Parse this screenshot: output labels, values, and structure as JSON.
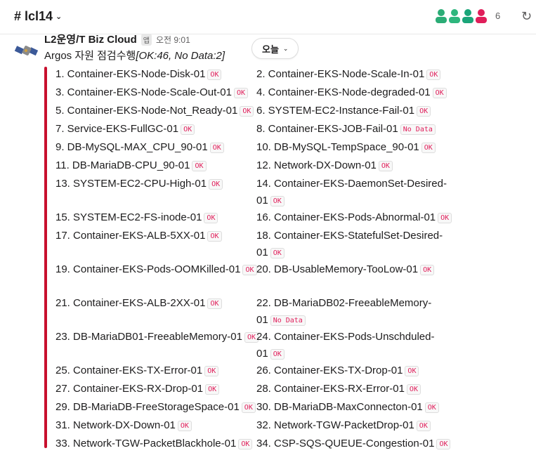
{
  "channel": {
    "name": "# lcl14"
  },
  "members": {
    "count": "6"
  },
  "message": {
    "sender": "L2운영/T Biz Cloud",
    "app_badge": "앱",
    "time": "오전 9:01",
    "title_prefix": "Argos 자원 점검수행",
    "title_status": "[OK:46, No Data:2]"
  },
  "date_divider": {
    "label": "오늘"
  },
  "colors": {
    "accent_bar": "#c8102e",
    "tag_text": "#e01e5a"
  },
  "checks": [
    {
      "label": "1. Container-EKS-Node-Disk-01",
      "status": "OK"
    },
    {
      "label": "2. Container-EKS-Node-Scale-In-01",
      "status": "OK"
    },
    {
      "label": "3. Container-EKS-Node-Scale-Out-01",
      "status": "OK"
    },
    {
      "label": "4. Container-EKS-Node-degraded-01",
      "status": "OK"
    },
    {
      "label": "5. Container-EKS-Node-Not_Ready-01",
      "status": "OK"
    },
    {
      "label": "6. SYSTEM-EC2-Instance-Fail-01",
      "status": "OK"
    },
    {
      "label": "7. Service-EKS-FullGC-01",
      "status": "OK"
    },
    {
      "label": "8. Container-EKS-JOB-Fail-01",
      "status": "No Data"
    },
    {
      "label": "9. DB-MySQL-MAX_CPU_90-01",
      "status": "OK"
    },
    {
      "label": "10. DB-MySQL-TempSpace_90-01",
      "status": "OK"
    },
    {
      "label": "11. DB-MariaDB-CPU_90-01",
      "status": "OK"
    },
    {
      "label": "12. Network-DX-Down-01",
      "status": "OK"
    },
    {
      "label": "13. SYSTEM-EC2-CPU-High-01",
      "status": "OK"
    },
    {
      "label": "14. Container-EKS-DaemonSet-Desired-01",
      "status": "OK"
    },
    {
      "label": "15. SYSTEM-EC2-FS-inode-01",
      "status": "OK"
    },
    {
      "label": "16. Container-EKS-Pods-Abnormal-01",
      "status": "OK"
    },
    {
      "label": "17. Container-EKS-ALB-5XX-01",
      "status": "OK"
    },
    {
      "label": "18. Container-EKS-StatefulSet-Desired-01",
      "status": "OK"
    },
    {
      "label": "19. Container-EKS-Pods-OOMKilled-01",
      "status": "OK"
    },
    {
      "label": "20. DB-UsableMemory-TooLow-01",
      "status": "OK"
    },
    {
      "label": "21. Container-EKS-ALB-2XX-01",
      "status": "OK"
    },
    {
      "label": "22. DB-MariaDB02-FreeableMemory-01",
      "status": "No Data"
    },
    {
      "label": "23. DB-MariaDB01-FreeableMemory-01",
      "status": "OK"
    },
    {
      "label": "24. Container-EKS-Pods-Unschduled-01",
      "status": "OK"
    },
    {
      "label": "25. Container-EKS-TX-Error-01",
      "status": "OK"
    },
    {
      "label": "26. Container-EKS-TX-Drop-01",
      "status": "OK"
    },
    {
      "label": "27. Container-EKS-RX-Drop-01",
      "status": "OK"
    },
    {
      "label": "28. Container-EKS-RX-Error-01",
      "status": "OK"
    },
    {
      "label": "29. DB-MariaDB-FreeStorageSpace-01",
      "status": "OK"
    },
    {
      "label": "30. DB-MariaDB-MaxConnecton-01",
      "status": "OK"
    },
    {
      "label": "31. Network-DX-Down-01",
      "status": "OK"
    },
    {
      "label": "32. Network-TGW-PacketDrop-01",
      "status": "OK"
    },
    {
      "label": "33. Network-TGW-PacketBlackhole-01",
      "status": "OK"
    },
    {
      "label": "34. CSP-SQS-QUEUE-Congestion-01",
      "status": "OK"
    }
  ]
}
